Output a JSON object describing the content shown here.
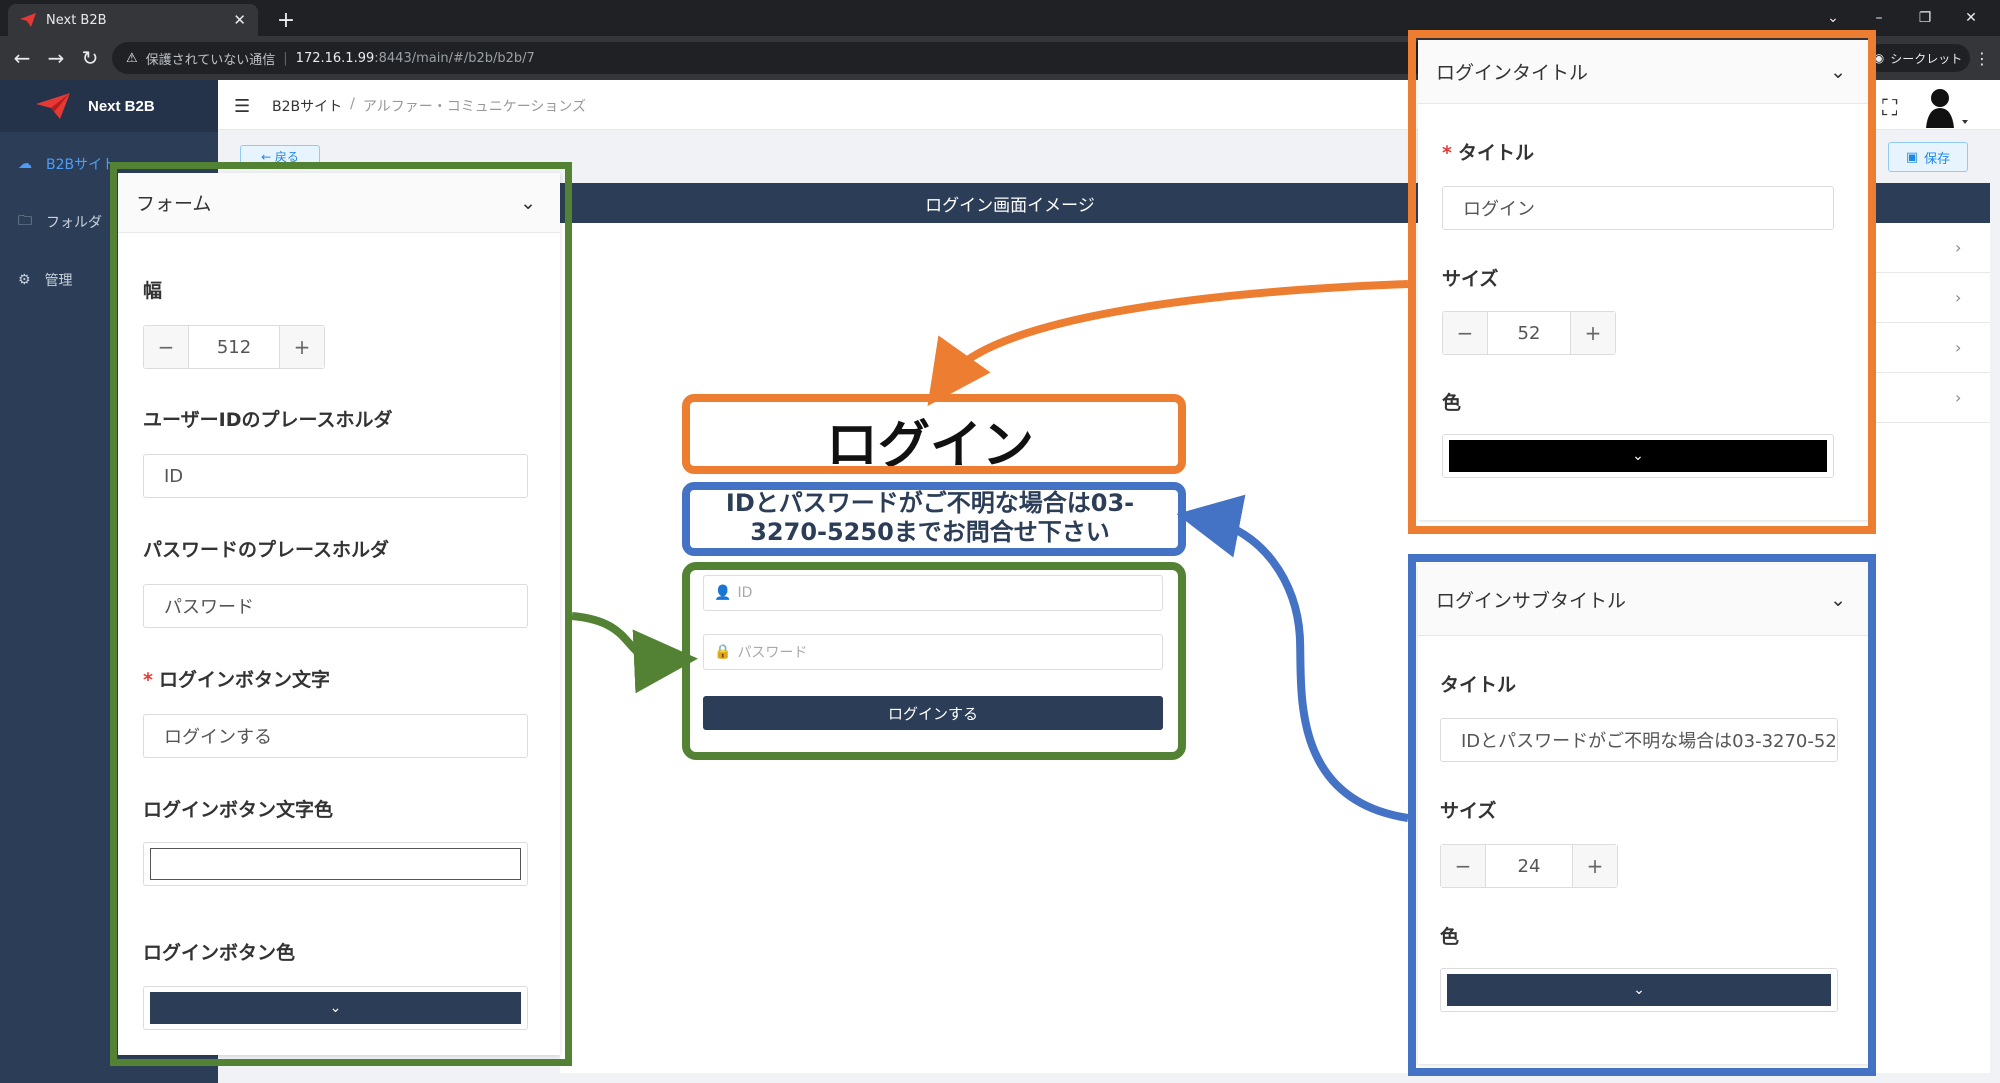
{
  "browser": {
    "tab_title": "Next B2B",
    "url_warning": "保護されていない通信",
    "url_host": "172.16.1.99",
    "url_path": ":8443/main/#/b2b/b2b/7",
    "incognito_label": "シークレット"
  },
  "app": {
    "logo_text": "Next B2B",
    "sidebar": [
      {
        "label": "B2Bサイト",
        "icon": "cloud-icon",
        "active": true
      },
      {
        "label": "フォルダ",
        "icon": "folder-icon",
        "active": false
      },
      {
        "label": "管理",
        "icon": "gear-icon",
        "active": false
      }
    ],
    "breadcrumb": [
      "B2Bサイト",
      "アルファー・コミュニケーションズ"
    ],
    "back_label": "← 戻る",
    "save_label": "保存",
    "preview_header": "ログイン画面イメージ"
  },
  "preview": {
    "title": "ログイン",
    "subtitle": "IDとパスワードがご不明な場合は03-3270-5250までお問合せ下さい",
    "id_placeholder": "ID",
    "password_placeholder": "パスワード",
    "button_label": "ログインする"
  },
  "form_panel": {
    "header": "フォーム",
    "width_label": "幅",
    "width_value": "512",
    "userid_ph_label": "ユーザーIDのプレースホルダ",
    "userid_ph_value": "ID",
    "pw_ph_label": "パスワードのプレースホルダ",
    "pw_ph_value": "パスワード",
    "btn_text_label": "ログインボタン文字",
    "btn_text_value": "ログインする",
    "btn_text_color_label": "ログインボタン文字色",
    "btn_text_color": "#ffffff",
    "btn_color_label": "ログインボタン色",
    "btn_color": "#2c3e57"
  },
  "title_panel": {
    "header": "ログインタイトル",
    "title_label": "タイトル",
    "title_value": "ログイン",
    "size_label": "サイズ",
    "size_value": "52",
    "color_label": "色",
    "color": "#000000"
  },
  "subtitle_panel": {
    "header": "ログインサブタイトル",
    "title_label": "タイトル",
    "title_value": "IDとパスワードがご不明な場合は03-3270-5250までお問合せ下さい",
    "size_label": "サイズ",
    "size_value": "24",
    "color_label": "色",
    "color": "#2c3e57"
  },
  "annotation_colors": {
    "green": "#548235",
    "orange": "#ed7d31",
    "blue": "#4472c4"
  }
}
